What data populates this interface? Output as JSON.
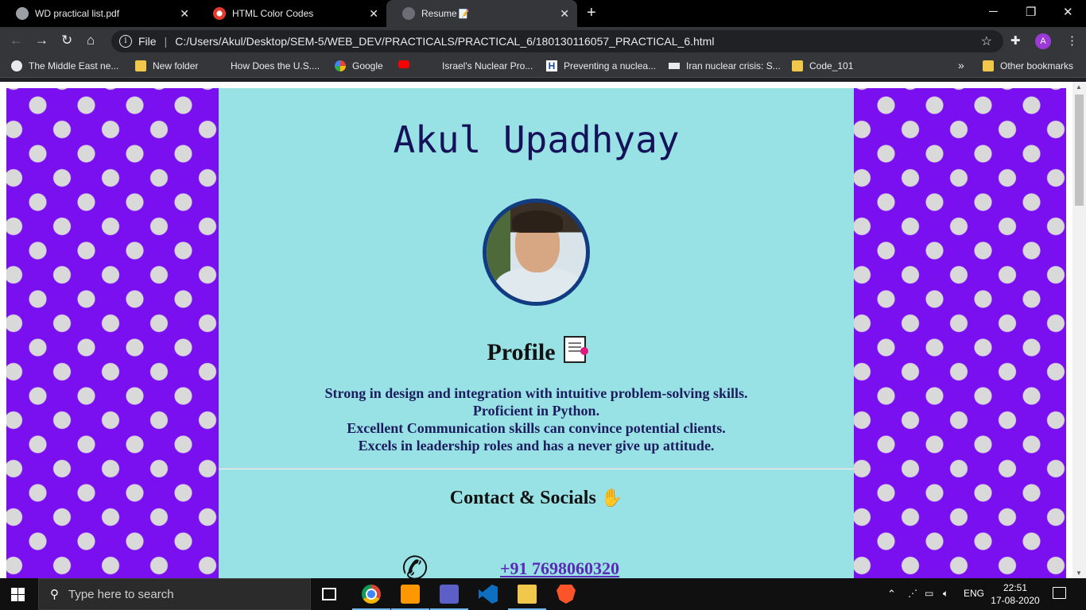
{
  "browser": {
    "tabs": [
      {
        "title": "WD practical list.pdf",
        "active": false
      },
      {
        "title": "HTML Color Codes",
        "active": false
      },
      {
        "title": "Resume",
        "active": true
      }
    ],
    "address": {
      "scheme_label": "File",
      "url": "C:/Users/Akul/Desktop/SEM-5/WEB_DEV/PRACTICALS/PRACTICAL_6/180130116057_PRACTICAL_6.html"
    },
    "profile_initial": "A",
    "bookmarks": [
      "The Middle East ne...",
      "New folder",
      "How Does the U.S....",
      "Google",
      "",
      "Israel's Nuclear Pro...",
      "Preventing a nuclea...",
      "Iran nuclear crisis: S...",
      "Code_101"
    ],
    "bookmarks_overflow": "»",
    "other_bookmarks": "Other bookmarks"
  },
  "page": {
    "name": "Akul Upadhyay",
    "profile_heading": "Profile",
    "profile_lines": [
      "Strong in design and integration with intuitive problem-solving skills.",
      "Proficient in Python.",
      "Excellent Communication skills can convince potential clients.",
      "Excels in leadership roles and has a never give up attitude."
    ],
    "contact_heading": "Contact & Socials",
    "phone": "+91 7698060320",
    "colors": {
      "polka_bg": "#7a0ff0",
      "content_bg": "#98e2e6",
      "heading": "#16125a",
      "link": "#5a2bb5"
    }
  },
  "taskbar": {
    "search_placeholder": "Type here to search",
    "language": "ENG",
    "time": "22:51",
    "date": "17-08-2020"
  }
}
